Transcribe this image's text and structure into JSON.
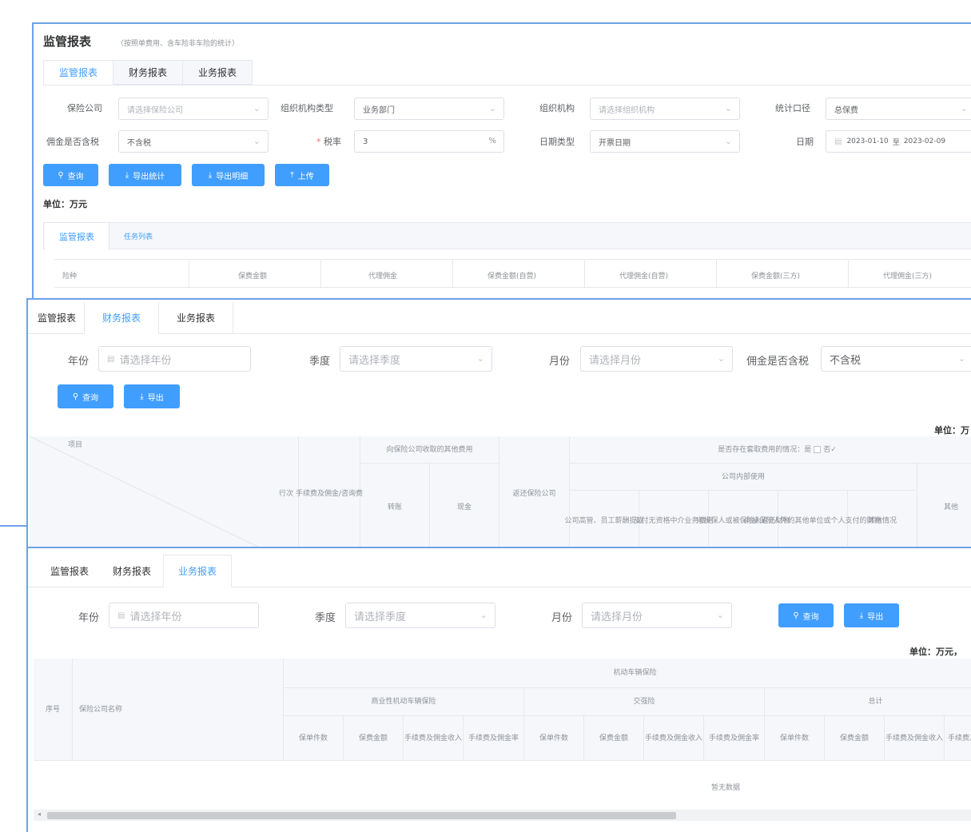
{
  "panel1": {
    "title": "监管报表",
    "note": "（按照单费用、含车险非车险的统计）",
    "tabs": [
      "监管报表",
      "财务报表",
      "业务报表"
    ],
    "fields": {
      "insurer_label": "保险公司",
      "insurer_placeholder": "请选择保险公司",
      "org_type_label": "组织机构类型",
      "org_type_value": "业务部门",
      "org_label": "组织机构",
      "org_placeholder": "请选择组织机构",
      "stat_label": "统计口径",
      "stat_value": "总保费",
      "commission_tax_label": "佣金是否含税",
      "commission_tax_value": "不含税",
      "tax_label": "税率",
      "tax_value": "3",
      "tax_suffix": "%",
      "date_type_label": "日期类型",
      "date_type_value": "开票日期",
      "date_label": "日期",
      "date_from": "2023-01-10",
      "date_sep": "至",
      "date_to": "2023-02-09"
    },
    "buttons": {
      "query": "查询",
      "export_stat": "导出统计",
      "export_detail": "导出明细",
      "upload": "上传"
    },
    "unit": "单位：万元",
    "subtabs": [
      "监管报表",
      "任务列表"
    ],
    "table_headers": [
      "险种",
      "保费金额",
      "代理佣金",
      "保费金额(自营)",
      "代理佣金(自营)",
      "保费金额(三方)",
      "代理佣金(三方)"
    ]
  },
  "panel2": {
    "tabs": [
      "监管报表",
      "财务报表",
      "业务报表"
    ],
    "year_label": "年份",
    "year_placeholder": "请选择年份",
    "quarter_label": "季度",
    "quarter_placeholder": "请选择季度",
    "month_label": "月份",
    "month_placeholder": "请选择月份",
    "tax_label": "佣金是否含税",
    "tax_value": "不含税",
    "buttons": {
      "query": "查询",
      "export": "导出"
    },
    "unit": "单位：万",
    "headers": {
      "item": "项目",
      "row_no": "行次",
      "fee": "手续费及佣金/咨询费",
      "to_insurer": "向保险公司收取的其他费用",
      "transfer": "转账",
      "cash": "现金",
      "return_to": "返还保险公司",
      "rebate_q": "是否存在套取费用的情况：是",
      "rebate_no": "否",
      "internal": "公司内部使用",
      "c1": "公司高管、员工薪酬提成",
      "c2": "支付无资格中介业务费用",
      "c3": "向投保人或被保险人返还财物",
      "c4": "向被保险人外的其他单位或个人支付的财物",
      "c5": "其他情况",
      "other": "其他"
    }
  },
  "panel3": {
    "tabs": [
      "监管报表",
      "财务报表",
      "业务报表"
    ],
    "year_label": "年份",
    "year_placeholder": "请选择年份",
    "quarter_label": "季度",
    "quarter_placeholder": "请选择季度",
    "month_label": "月份",
    "month_placeholder": "请选择月份",
    "buttons": {
      "query": "查询",
      "export": "导出"
    },
    "unit": "单位：万元，",
    "headers": {
      "seq": "序号",
      "name": "保险公司名称",
      "motor": "机动车辆保险",
      "commercial": "商业性机动车辆保险",
      "compulsory": "交强险",
      "total": "总计",
      "cols": [
        "保单件数",
        "保费金额",
        "手续费及佣金收入",
        "手续费及佣金率"
      ]
    },
    "empty": "暂无数据"
  },
  "colors": {
    "primary": "#409eff",
    "frame": "#6ea1e8"
  }
}
